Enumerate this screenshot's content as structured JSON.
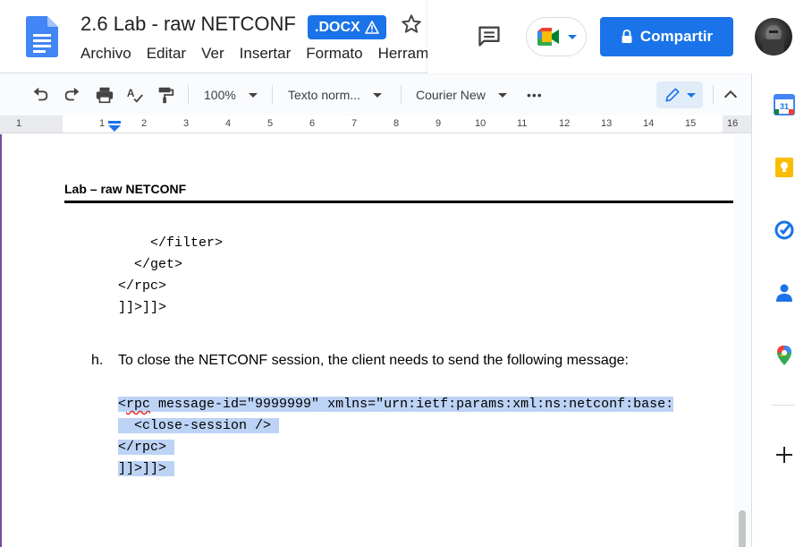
{
  "document": {
    "title": "2.6 Lab - raw NETCONF",
    "format_badge": ".DOCX"
  },
  "menu": [
    "Archivo",
    "Editar",
    "Ver",
    "Insertar",
    "Formato",
    "Herramientas"
  ],
  "topbar": {
    "share_label": "Compartir"
  },
  "toolbar": {
    "zoom": "100%",
    "style": "Texto norm...",
    "font": "Courier New",
    "more": "•••"
  },
  "ruler": {
    "numbers": [
      "1",
      "1",
      "2",
      "3",
      "4",
      "5",
      "6",
      "7",
      "8",
      "9",
      "10",
      "11",
      "12",
      "13",
      "14",
      "15",
      "16"
    ]
  },
  "page": {
    "header": "Lab – raw NETCONF",
    "code_top": [
      "    </filter>",
      "  </get>",
      "</rpc>",
      "]]>]]>"
    ],
    "step_letter": "h.",
    "step_text": "To close the NETCONF session, the client needs to send the following message:",
    "code_bottom": {
      "line1_word": "rpc",
      "line1_rest": " message-id=\"9999999\" xmlns=\"urn:ietf:params:xml:ns:netconf:base:",
      "line2": "  <close-session />",
      "line3": "</rpc>",
      "line4": "]]>]]>"
    }
  },
  "colors": {
    "accent": "#1a73e8",
    "selection": "#bcd3f5",
    "edit_mode_bg": "#e1ecf9"
  },
  "sidepanel": {
    "icons": [
      "calendar-icon",
      "keep-icon",
      "tasks-icon",
      "contacts-icon",
      "maps-icon",
      "add-icon"
    ],
    "calendar_day": "31"
  }
}
